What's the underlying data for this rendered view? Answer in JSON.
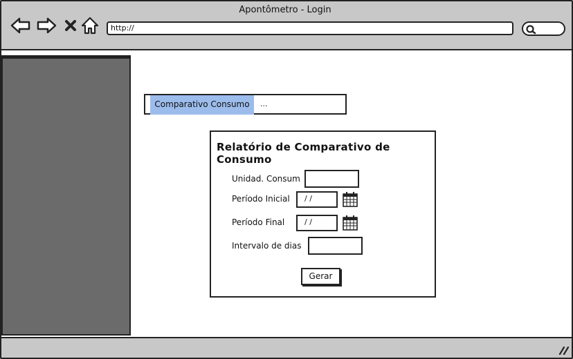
{
  "window": {
    "title": "Apontômetro - Login"
  },
  "toolbar": {
    "back_icon": "back-arrow-icon",
    "forward_icon": "forward-arrow-icon",
    "stop_icon": "close-icon",
    "home_icon": "home-icon",
    "url_value": "http://",
    "search_icon": "search-icon"
  },
  "tabs": {
    "active_label": "Comparativo Consumo",
    "more_label": "..."
  },
  "form": {
    "title": "Relatório de Comparativo de Consumo",
    "unidad_label": "Unidad. Consum",
    "unidad_value": "",
    "periodo_inicial_label": "Período Inicial",
    "periodo_inicial_value": "/ /",
    "periodo_final_label": "Período Final",
    "periodo_final_value": "/ /",
    "intervalo_label": "Intervalo de dias",
    "intervalo_value": "",
    "calendar_icon": "calendar-icon",
    "submit_label": "Gerar"
  },
  "colors": {
    "chrome": "#c8c8c8",
    "sidebar": "#6b6b6b",
    "tab_active": "#9cbcec",
    "border": "#222222"
  }
}
